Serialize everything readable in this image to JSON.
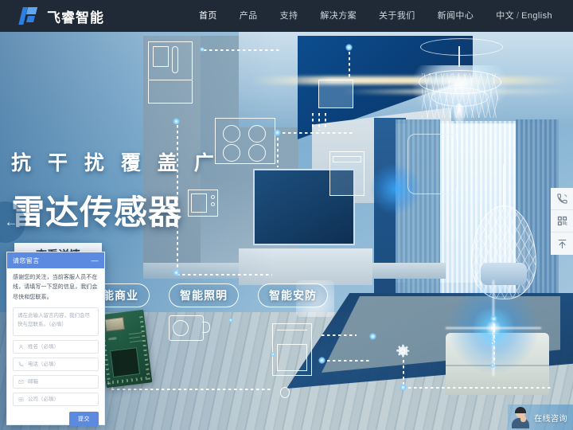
{
  "header": {
    "logo_text": "飞睿智能",
    "nav": [
      {
        "label": "首页",
        "active": true
      },
      {
        "label": "产品",
        "active": false
      },
      {
        "label": "支持",
        "active": false
      },
      {
        "label": "解决方案",
        "active": false
      },
      {
        "label": "关于我们",
        "active": false
      },
      {
        "label": "新闻中心",
        "active": false
      }
    ],
    "lang_cn": "中文",
    "lang_sep": "/",
    "lang_en": "English"
  },
  "hero": {
    "subtitle": "抗 干 扰   覆 盖 广",
    "title": "雷达传感器",
    "detail_button": "查看详情",
    "prev_arrow": "←"
  },
  "tags": [
    {
      "label": "智能商业"
    },
    {
      "label": "智能照明"
    },
    {
      "label": "智能安防"
    }
  ],
  "dock": [
    {
      "name": "phone-icon",
      "title": "电话"
    },
    {
      "name": "qrcode-icon",
      "title": "二维码"
    },
    {
      "name": "back-to-top-icon",
      "title": "返回顶部"
    }
  ],
  "service": {
    "label": "在线咨询"
  },
  "chat": {
    "title": "请您留言",
    "minimize": "—",
    "message": "感谢您的关注，当前客服人员不在线，请填写一下您的信息，我们会尽快和您联系。",
    "textarea_placeholder": "请在此输入留言内容，我们会尽快与您联系。（必填）",
    "fields": [
      {
        "icon": "user-icon",
        "placeholder": "姓名（必填）",
        "value": ""
      },
      {
        "icon": "phone-icon",
        "placeholder": "电话（必填）",
        "value": ""
      },
      {
        "icon": "mail-icon",
        "placeholder": "邮箱",
        "value": ""
      },
      {
        "icon": "company-icon",
        "placeholder": "公司（必填）",
        "value": ""
      }
    ],
    "submit_label": "提交"
  },
  "colors": {
    "header_bg": "#1f2a36",
    "accent_blue": "#5b8ae0",
    "logo_blue": "#2f7fe0",
    "hero_text": "#ffffff"
  }
}
